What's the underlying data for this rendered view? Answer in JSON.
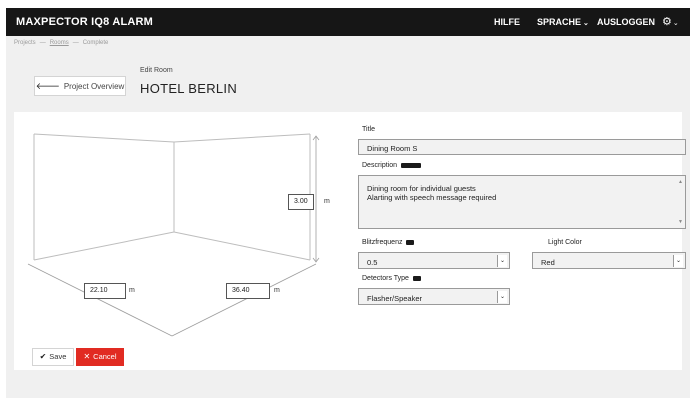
{
  "app": {
    "brand": "MAXPECTOR IQ8 ALARM",
    "nav": {
      "help": "HILFE",
      "language": "SPRACHE",
      "logout": "AUSLOGGEN"
    }
  },
  "breadcrumb": {
    "items": [
      "Projects",
      "Rooms",
      "Complete"
    ]
  },
  "header": {
    "back_label": "Project Overview",
    "subtitle": "Edit Room",
    "title": "HOTEL BERLIN"
  },
  "room": {
    "width": "22.10",
    "depth": "36.40",
    "height": "3.00",
    "unit": "m"
  },
  "form": {
    "title_label": "Title",
    "title_value": "Dining Room S",
    "description_label": "Description",
    "description_value": "Dining room for individual guests\nAlarting with speech message required",
    "flash_label": "Blitzfrequenz",
    "flash_value": "0.5",
    "light_color_label": "Light Color",
    "light_color_value": "Red",
    "detectors_label": "Detectors Type",
    "detectors_value": "Flasher/Speaker"
  },
  "actions": {
    "save_label": "Save",
    "cancel_label": "Cancel"
  },
  "colors": {
    "topbar": "#161616",
    "cancel": "#e12b22",
    "background": "#f0f0f0"
  },
  "icons": {
    "settings": "gear-icon",
    "dropdown": "chevron-down-icon",
    "back": "arrow-left-icon",
    "save": "check-icon",
    "cancel": "close-icon",
    "info": "info-badge-icon"
  }
}
